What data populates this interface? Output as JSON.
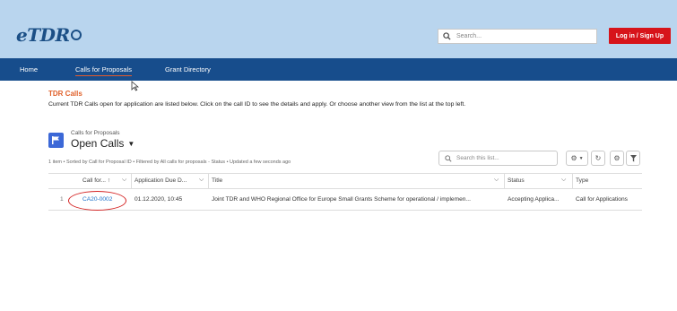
{
  "header": {
    "logo_text": "eTDR",
    "search_placeholder": "Search...",
    "login_label": "Log in / Sign Up"
  },
  "nav": {
    "items": [
      "Home",
      "Calls for Proposals",
      "Grant Directory"
    ],
    "active": "Calls for Proposals"
  },
  "page": {
    "title": "TDR Calls",
    "description": "Current TDR Calls open for application are listed below. Click on the call ID to see the details and apply. Or choose another view from the list at the top left."
  },
  "list_view": {
    "object_label": "Calls for Proposals",
    "name": "Open Calls",
    "meta": "1 item • Sorted by Call for Proposal ID • Filtered by All calls for proposals - Status • Updated a few seconds ago",
    "search_placeholder": "Search this list..."
  },
  "table": {
    "columns": [
      "Call for...",
      "Application Due D...",
      "Title",
      "Status",
      "Type"
    ],
    "rows": [
      {
        "num": "1",
        "call_id": "CA20-0002",
        "due": "01.12.2020, 10:45",
        "title": "Joint TDR and WHO Regional Office for Europe Small Grants Scheme for operational / implemen...",
        "status": "Accepting Applica...",
        "type": "Call for Applications"
      }
    ]
  },
  "colors": {
    "header_bg": "#b9d5ee",
    "nav_bg": "#174d8c",
    "login_button": "#d7141a",
    "title_accent": "#e0612b",
    "link": "#1a6fc9",
    "highlight_circle": "#d42323"
  }
}
